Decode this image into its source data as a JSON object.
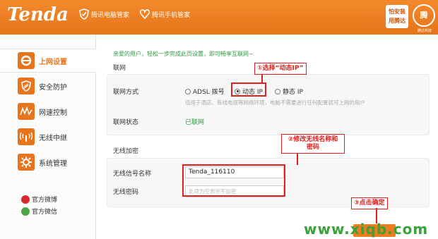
{
  "header": {
    "logo": "Tenda",
    "badge1": "腾讯电脑管家",
    "badge2": "腾讯手机管家",
    "install_line1": "怕安装",
    "install_line2": "用腾达",
    "brand_caption": "腾达科技"
  },
  "sidebar": {
    "items": [
      {
        "label": "上网设置",
        "icon": "ie-icon"
      },
      {
        "label": "安全防护",
        "icon": "shield-icon"
      },
      {
        "label": "网速控制",
        "icon": "speed-icon"
      },
      {
        "label": "无线中继",
        "icon": "wifi-relay-icon"
      },
      {
        "label": "系统管理",
        "icon": "gear-icon"
      }
    ],
    "weibo": "官方微博",
    "wechat": "官方微信"
  },
  "main": {
    "welcome": "亲爱的用户，轻松一步完成此页设置，即可畅享互联网~",
    "network_title": "联网",
    "conn_mode_label": "联网方式",
    "options": [
      "ADSL 拨号",
      "动态 IP",
      "静态 IP"
    ],
    "selected_option": "动态 IP",
    "hint": "适用于酒店、有线电视等网络环境，电脑不需要进行任何配置就可上网的用户",
    "status_label": "联网状态",
    "status_value": "已联网",
    "wireless_title": "无线加密",
    "ssid_label": "无线信号名称",
    "ssid_value": "Tenda_116110",
    "pwd_label": "无线密码",
    "pwd_placeholder": "此项为空表示不加密"
  },
  "annotations": {
    "a1": "①选择“动态IP”",
    "a2_line1": "②修改无线名称和",
    "a2_line2": "密码",
    "a3": "③点击确定"
  },
  "watermark": "www.xiqb.com",
  "colors": {
    "brand": "#e8741c",
    "status_green": "#2d9b3e",
    "annotation": "#e02020"
  }
}
